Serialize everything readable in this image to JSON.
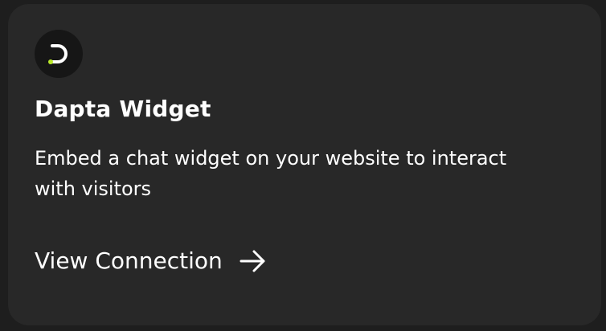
{
  "card": {
    "logo_icon": "dapta-logo-icon",
    "title": "Dapta Widget",
    "description": "Embed a chat widget on your website to interact with visitors",
    "action_label": "View Connection",
    "action_icon": "arrow-right-icon"
  },
  "colors": {
    "page_background": "#1e1e1e",
    "card_background": "#282828",
    "logo_background": "#161616",
    "logo_accent": "#b9e82a",
    "text": "#ffffff"
  }
}
